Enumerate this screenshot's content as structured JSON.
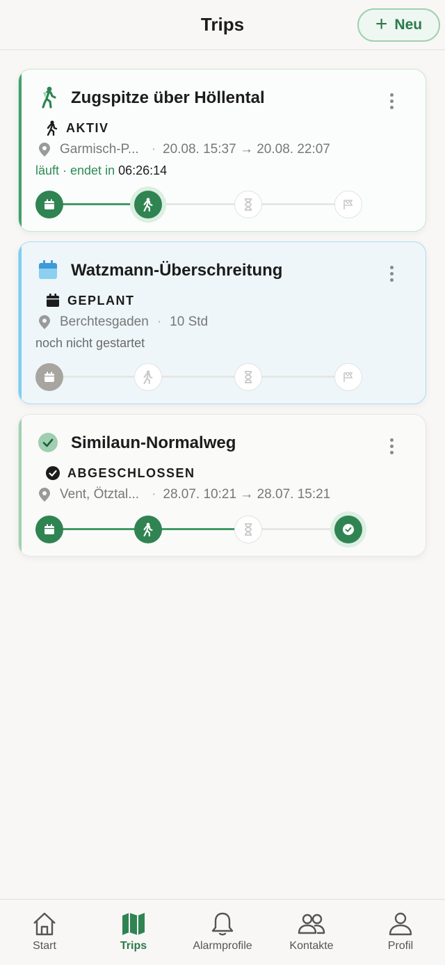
{
  "header": {
    "title": "Trips",
    "new_button_label": "Neu"
  },
  "trips": [
    {
      "title": "Zugspitze über Höllental",
      "status": "AKTIV",
      "location": "Garmisch-P...",
      "schedule": "20.08. 15:37 → 20.08. 22:07",
      "progress_text": "läuft · endet in",
      "countdown": "06:26:14",
      "stage": "active"
    },
    {
      "title": "Watzmann-Überschreitung",
      "status": "GEPLANT",
      "location": "Berchtesgaden",
      "duration": "10 Std",
      "progress_text": "noch nicht gestartet",
      "stage": "planned"
    },
    {
      "title": "Similaun-Normalweg",
      "status": "ABGESCHLOSSEN",
      "location": "Vent, Ötztal...",
      "schedule": "28.07. 10:21 → 28.07. 15:21",
      "stage": "completed"
    }
  ],
  "nav": {
    "items": [
      {
        "label": "Start",
        "icon": "house-icon"
      },
      {
        "label": "Trips",
        "icon": "map-icon"
      },
      {
        "label": "Alarmprofile",
        "icon": "bell-icon"
      },
      {
        "label": "Kontakte",
        "icon": "people-icon"
      },
      {
        "label": "Profil",
        "icon": "person-icon"
      }
    ],
    "current": "Trips"
  },
  "colors": {
    "accent_green": "#2f8452",
    "planned_blue": "#7fcdf0",
    "background": "#f8f7f5"
  }
}
